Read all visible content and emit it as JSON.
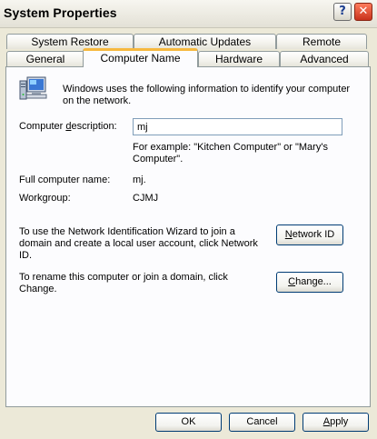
{
  "window": {
    "title": "System Properties",
    "help_glyph": "?",
    "close_glyph": "✕"
  },
  "tabs_top": [
    {
      "label": "System Restore"
    },
    {
      "label": "Automatic Updates"
    },
    {
      "label": "Remote"
    }
  ],
  "tabs_bottom": [
    {
      "label": "General"
    },
    {
      "label": "Computer Name",
      "active": true
    },
    {
      "label": "Hardware"
    },
    {
      "label": "Advanced"
    }
  ],
  "content": {
    "intro": "Windows uses the following information to identify your computer on the network.",
    "description_label": {
      "pre": "Computer ",
      "key": "d",
      "post": "escription:"
    },
    "description_value": "mj",
    "example": "For example: \"Kitchen Computer\" or \"Mary's Computer\".",
    "full_name_label": "Full computer name:",
    "full_name_value": "mj.",
    "workgroup_label": "Workgroup:",
    "workgroup_value": "CJMJ",
    "network_id_text": "To use the Network Identification Wizard to join a domain and create a local user account, click Network ID.",
    "network_id_button": {
      "key": "N",
      "rest": "etwork ID"
    },
    "rename_text": "To rename this computer or join a domain, click Change.",
    "change_button": {
      "key": "C",
      "rest": "hange..."
    }
  },
  "footer": {
    "ok": "OK",
    "cancel": "Cancel",
    "apply": {
      "key": "A",
      "rest": "pply"
    }
  }
}
